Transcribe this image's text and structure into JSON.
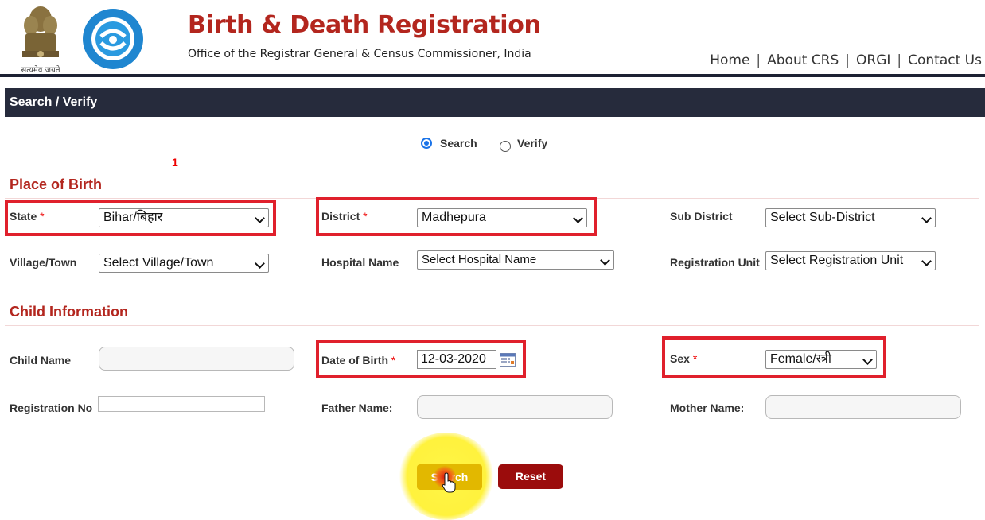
{
  "header": {
    "emblem_motto": "सत्यमेव जयते",
    "title": "Birth & Death Registration",
    "subtitle": "Office of the Registrar General & Census Commissioner, India",
    "nav": [
      "Home",
      "About CRS",
      "ORGI",
      "Contact Us"
    ],
    "nav_separator": "|"
  },
  "section_bar": {
    "title": "Search / Verify"
  },
  "mode": {
    "options": [
      "Search",
      "Verify"
    ],
    "selected": "Search"
  },
  "stray_mark": "1",
  "place_of_birth": {
    "title": "Place of Birth",
    "state": {
      "label": "State",
      "required": "*",
      "value": "Bihar/बिहार"
    },
    "district": {
      "label": "District",
      "required": "*",
      "value": "Madhepura"
    },
    "sub_district": {
      "label": "Sub District",
      "value": "Select Sub-District"
    },
    "village_town": {
      "label": "Village/Town",
      "value": "Select Village/Town"
    },
    "hospital_name": {
      "label": "Hospital Name",
      "value": "Select Hospital Name"
    },
    "registration_unit": {
      "label": "Registration Unit",
      "value": "Select Registration Unit"
    }
  },
  "child_information": {
    "title": "Child Information",
    "child_name": {
      "label": "Child Name",
      "value": ""
    },
    "date_of_birth": {
      "label": "Date of Birth",
      "required": "*",
      "value": "12-03-2020"
    },
    "sex": {
      "label": "Sex",
      "required": "*",
      "value": "Female/स्त्री"
    },
    "registration_no": {
      "label": "Registration No",
      "value": ""
    },
    "father_name": {
      "label": "Father Name:",
      "value": ""
    },
    "mother_name": {
      "label": "Mother Name:",
      "value": ""
    }
  },
  "actions": {
    "search": "Search",
    "reset": "Reset"
  },
  "colors": {
    "brand_red": "#b3261e",
    "bar": "#262b3c",
    "highlight": "#e0202c",
    "search_btn": "#e2b800",
    "reset_btn": "#9b0c0c"
  }
}
